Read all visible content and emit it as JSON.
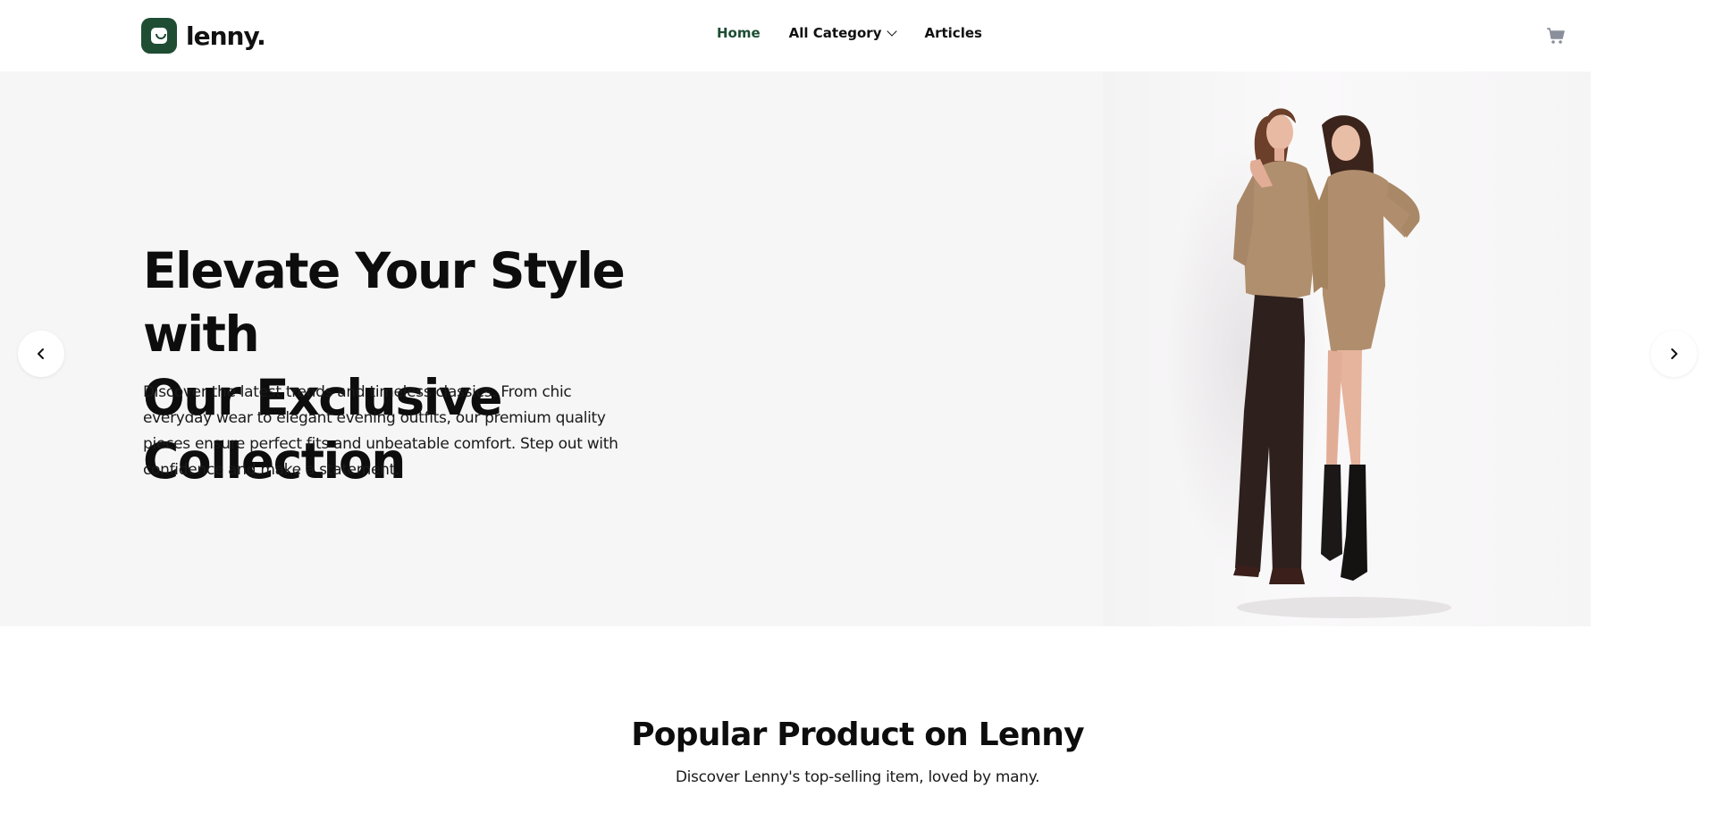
{
  "header": {
    "logo_text": "lenny.",
    "logo_icon": "shopping-bag-icon",
    "nav": [
      {
        "label": "Home",
        "active": true
      },
      {
        "label": "All Category",
        "has_dropdown": true
      },
      {
        "label": "Articles"
      }
    ],
    "cart_icon": "cart-icon"
  },
  "hero": {
    "title_line1": "Elevate Your Style with",
    "title_line2": "Our Exclusive Collection",
    "description": "Discover the latest trends and timeless classics. From chic everyday wear to elegant evening outfits, our premium quality pieces ensure perfect fits and unbeatable comfort. Step out with confidence and make a statement.",
    "prev_icon": "chevron-left-icon",
    "next_icon": "chevron-right-icon",
    "image": "two-women-fashion-photo"
  },
  "section": {
    "title": "Popular Product on Lenny",
    "subtitle": "Discover Lenny's top-selling item, loved by many."
  },
  "colors": {
    "brand": "#1e4d34",
    "hero_bg": "#f7f6f7",
    "text": "#111111"
  }
}
